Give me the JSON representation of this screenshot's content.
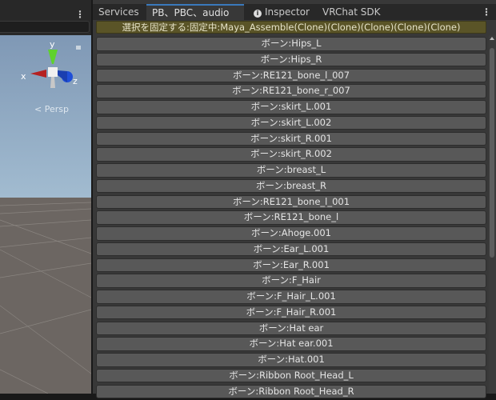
{
  "scene": {
    "persp_label": "< Persp",
    "axes": {
      "x": "x",
      "y": "y",
      "z": "z"
    }
  },
  "tabs": [
    {
      "label": "Services"
    },
    {
      "label": "PB、PBC、audioリスト"
    },
    {
      "label": "Inspector"
    },
    {
      "label": "VRChat SDK"
    }
  ],
  "lock_button": "選択を固定する:固定中:Maya_Assemble(Clone)(Clone)(Clone)(Clone)(Clone)",
  "bones": [
    "ボーン:Hips_L",
    "ボーン:Hips_R",
    "ボーン:RE121_bone_l_007",
    "ボーン:RE121_bone_r_007",
    "ボーン:skirt_L.001",
    "ボーン:skirt_L.002",
    "ボーン:skirt_R.001",
    "ボーン:skirt_R.002",
    "ボーン:breast_L",
    "ボーン:breast_R",
    "ボーン:RE121_bone_l_001",
    "ボーン:RE121_bone_l",
    "ボーン:Ahoge.001",
    "ボーン:Ear_L.001",
    "ボーン:Ear_R.001",
    "ボーン:F_Hair",
    "ボーン:F_Hair_L.001",
    "ボーン:F_Hair_R.001",
    "ボーン:Hat ear",
    "ボーン:Hat ear.001",
    "ボーン:Hat.001",
    "ボーン:Ribbon Root_Head_L",
    "ボーン:Ribbon Root_Head_R"
  ]
}
